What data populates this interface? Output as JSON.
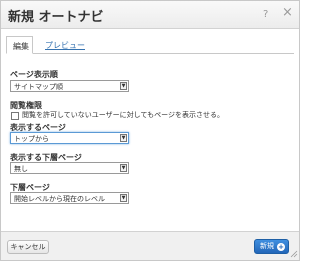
{
  "dialog": {
    "title": "新規 オートナビ",
    "help_label": "?",
    "close_label": "×"
  },
  "tabs": [
    {
      "label": "編集",
      "active": true
    },
    {
      "label": "プレビュー",
      "active": false
    }
  ],
  "fields": {
    "page_order": {
      "label": "ページ表示順",
      "value": "サイトマップ順"
    },
    "view_permission": {
      "label": "閲覧権限",
      "checkbox_label": "閲覧を許可していないユーザーに対してもページを表示させる。",
      "checked": false
    },
    "display_pages": {
      "label": "表示するページ",
      "value": "トップから"
    },
    "subpages": {
      "label": "表示する下層ページ",
      "value": "無し"
    },
    "lower_pages": {
      "label": "下層ページ",
      "value": "開始レベルから現在のレベル"
    }
  },
  "footer": {
    "cancel_label": "キャンセル",
    "new_label": "新規"
  },
  "colors": {
    "primary_button": "#2c74c9",
    "link": "#3572b0",
    "focus": "#5b9ad5"
  }
}
